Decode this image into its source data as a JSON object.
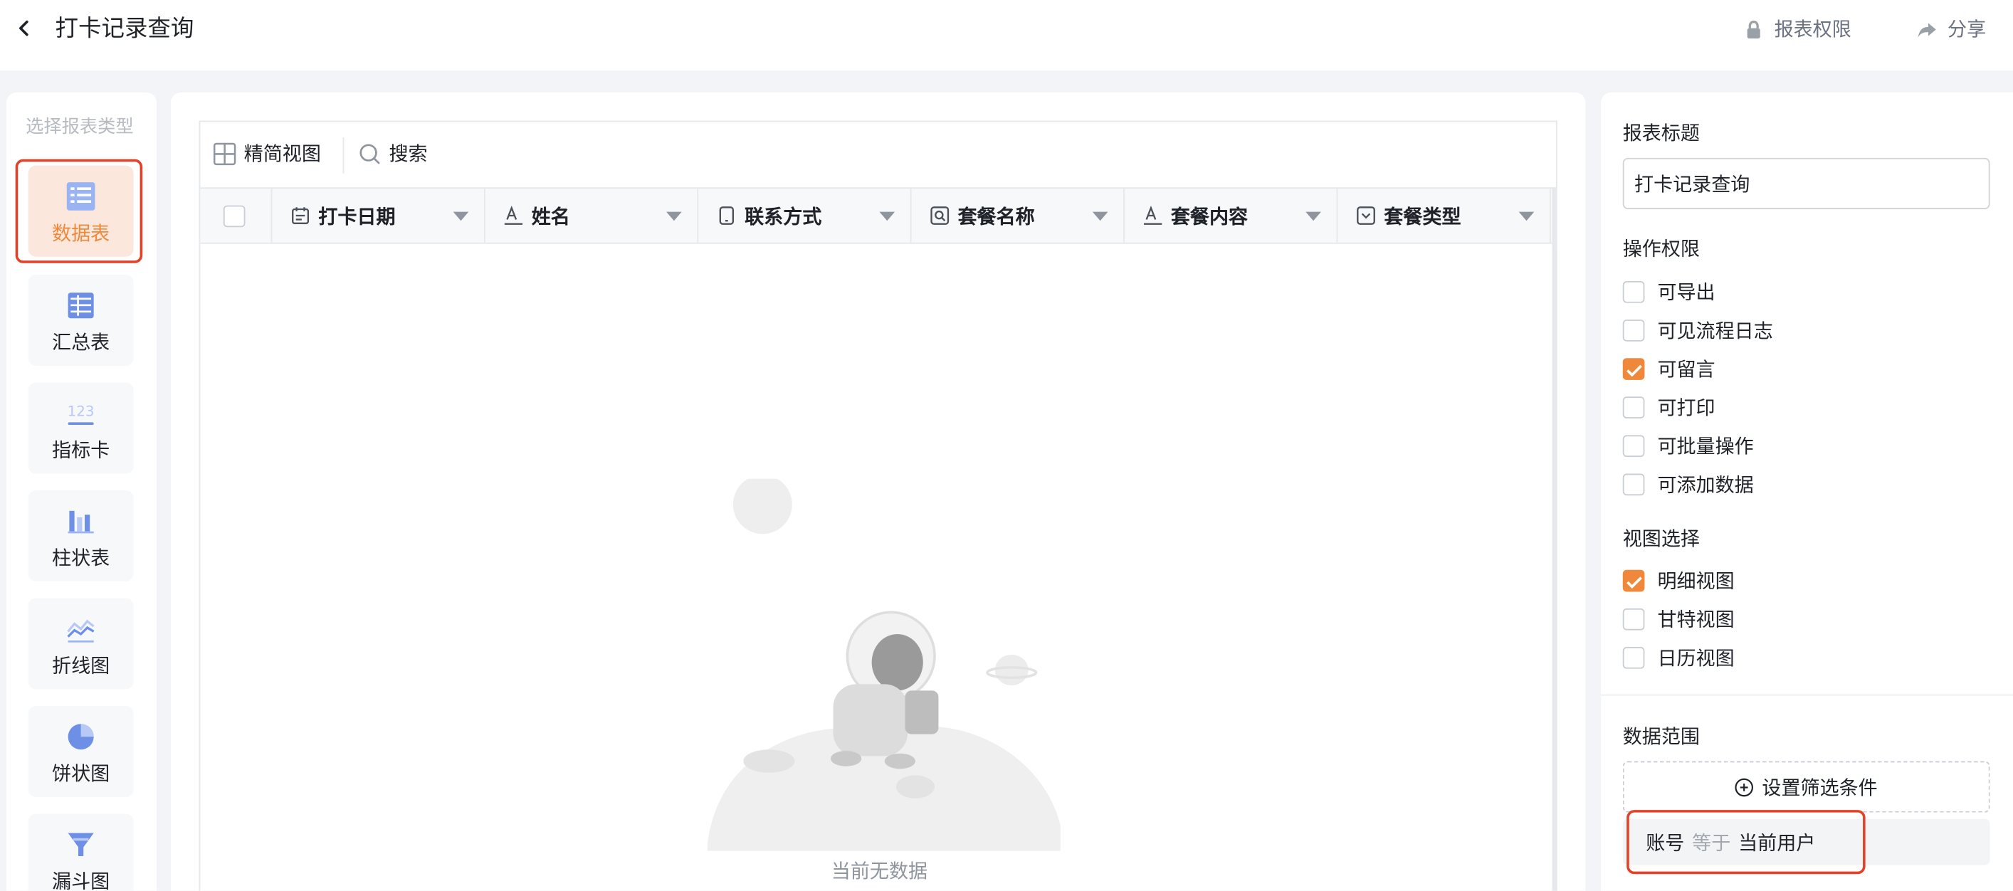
{
  "header": {
    "title": "打卡记录查询",
    "permissions_label": "报表权限",
    "share_label": "分享"
  },
  "sidebar": {
    "title": "选择报表类型",
    "items": [
      {
        "label": "数据表",
        "icon": "table-icon",
        "active": true
      },
      {
        "label": "汇总表",
        "icon": "pivot-table-icon"
      },
      {
        "label": "指标卡",
        "icon": "metric-card-icon"
      },
      {
        "label": "柱状表",
        "icon": "bar-chart-icon"
      },
      {
        "label": "折线图",
        "icon": "line-chart-icon"
      },
      {
        "label": "饼状图",
        "icon": "pie-chart-icon"
      },
      {
        "label": "漏斗图",
        "icon": "funnel-chart-icon"
      }
    ]
  },
  "table": {
    "compact_view_label": "精简视图",
    "search_label": "搜索",
    "columns": [
      {
        "label": "打卡日期",
        "icon": "date-field-icon"
      },
      {
        "label": "姓名",
        "icon": "text-field-icon"
      },
      {
        "label": "联系方式",
        "icon": "phone-field-icon"
      },
      {
        "label": "套餐名称",
        "icon": "lookup-field-icon"
      },
      {
        "label": "套餐内容",
        "icon": "text-field-icon"
      },
      {
        "label": "套餐类型",
        "icon": "select-field-icon"
      }
    ],
    "empty_text": "当前无数据"
  },
  "settings": {
    "title_heading": "报表标题",
    "title_value": "打卡记录查询",
    "operation_heading": "操作权限",
    "operations": [
      {
        "label": "可导出",
        "checked": false
      },
      {
        "label": "可见流程日志",
        "checked": false
      },
      {
        "label": "可留言",
        "checked": true
      },
      {
        "label": "可打印",
        "checked": false
      },
      {
        "label": "可批量操作",
        "checked": false
      },
      {
        "label": "可添加数据",
        "checked": false
      }
    ],
    "view_heading": "视图选择",
    "views": [
      {
        "label": "明细视图",
        "checked": true
      },
      {
        "label": "甘特视图",
        "checked": false
      },
      {
        "label": "日历视图",
        "checked": false
      }
    ],
    "data_range_heading": "数据范围",
    "filter_button_label": "设置筛选条件",
    "condition": {
      "field": "账号",
      "operator": "等于",
      "value": "当前用户"
    }
  },
  "colors": {
    "accent": "#f0883b",
    "highlight_frame": "#e2422a"
  }
}
